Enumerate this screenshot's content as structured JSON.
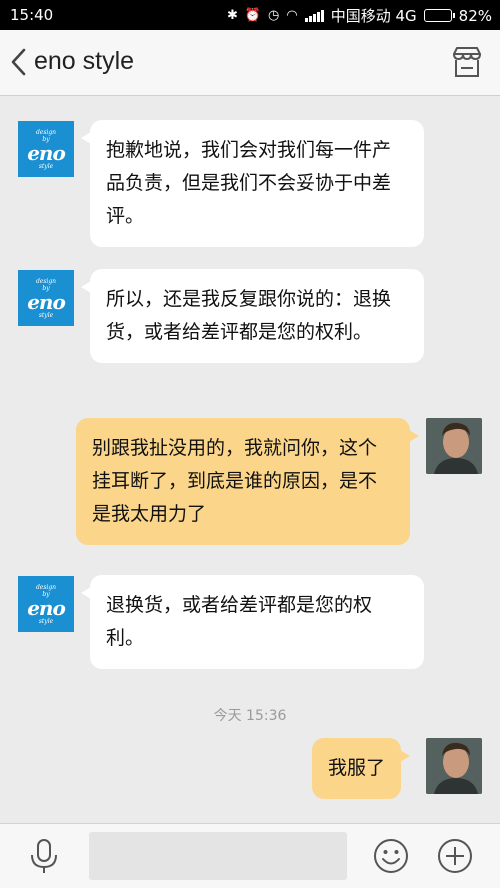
{
  "status_bar": {
    "time": "15:40",
    "carrier": "中国移动 4G",
    "battery": "82%",
    "battery_level": 0.82
  },
  "header": {
    "title": "eno style",
    "back_icon": "chevron-left-icon",
    "shop_icon": "store-icon"
  },
  "shop_avatar": {
    "line1": "design",
    "line2": "by",
    "line3": "eno",
    "line4": "style"
  },
  "messages": [
    {
      "sender": "shop",
      "text": "抱歉地说，我们会对我们每一件产品负责，但是我们不会妥协于中差评。"
    },
    {
      "sender": "shop",
      "text": "所以，还是我反复跟你说的：退换货，或者给差评都是您的权利。"
    },
    {
      "sender": "user",
      "text": "别跟我扯没用的，我就问你，这个挂耳断了，到底是谁的原因，是不是我太用力了"
    },
    {
      "sender": "shop",
      "text": "退换货，或者给差评都是您的权利。"
    },
    {
      "sender": "user",
      "text": "我服了"
    }
  ],
  "timestamp": "今天 15:36",
  "input_bar": {
    "voice_icon": "microphone-icon",
    "emoji_icon": "smiley-icon",
    "more_icon": "plus-circle-icon",
    "input_value": ""
  },
  "colors": {
    "background": "#ebebeb",
    "incoming_bubble": "#ffffff",
    "outgoing_bubble": "#fbd68a",
    "shop_avatar": "#1a8fd1"
  }
}
